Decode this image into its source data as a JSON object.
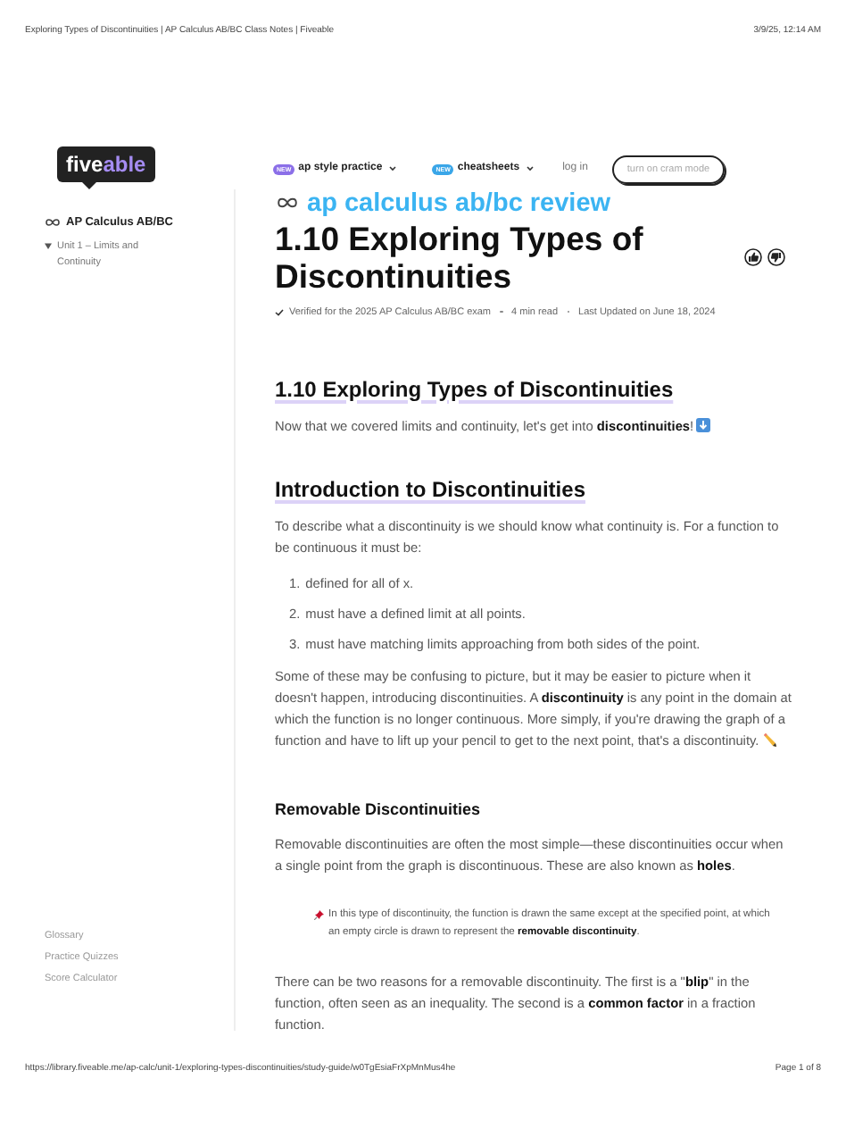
{
  "print_header": {
    "title": "Exploring Types of Discontinuities | AP Calculus AB/BC Class Notes | Fiveable",
    "datetime": "3/9/25, 12:14 AM"
  },
  "logo": [
    "five",
    "able"
  ],
  "nav": {
    "items": [
      {
        "badge": "NEW",
        "label": "ap style practice",
        "color": "#8b6fe8"
      },
      {
        "badge": "NEW",
        "label": "cheatsheets",
        "color": "#3aa6e8"
      }
    ],
    "login": "log in",
    "cram_button": "turn on cram mode"
  },
  "sidebar": {
    "course": "AP Calculus AB/BC",
    "unit": {
      "label": "Unit 1 – Limits and Continuity",
      "expanded": true
    },
    "links": [
      "Glossary",
      "Practice Quizzes",
      "Score Calculator"
    ]
  },
  "article": {
    "course_label": "ap calculus ab/bc review",
    "title": "1.10 Exploring Types of Discontinuities",
    "meta": [
      "Verified for the 2025 AP Calculus AB/BC exam",
      "4 min read",
      "Last Updated on June 18, 2024"
    ],
    "blocks": [
      {
        "kind": "h2",
        "text": "1.10 Exploring Types of Discontinuities"
      },
      {
        "kind": "p",
        "text": "Now that we covered limits and continuity, let's get into **discontinuities**!",
        "end_icon": {
          "kind": "arrow"
        }
      },
      {
        "kind": "h2",
        "text": "Introduction to Discontinuities"
      },
      {
        "kind": "p",
        "text": "To describe what a discontinuity is we should know what continuity is. For a function to be continuous it must be:"
      },
      {
        "kind": "ol",
        "items": [
          {
            "number": "1.",
            "text": "defined for all of x."
          },
          {
            "number": "2.",
            "text": "must have a defined limit at all points."
          },
          {
            "number": "3.",
            "text": "must have matching limits approaching from both sides of the point."
          }
        ]
      },
      {
        "kind": "p",
        "text": "Some of these may be confusing to picture, but it may be easier to picture when it doesn't happen, introducing discontinuities. A **discontinuity** is any point in the domain at which the function is no longer continuous. More simply, if you're drawing the graph of a function and have to lift up your pencil to get to the next point, that's a discontinuity.",
        "end_icon": {
          "kind": "pencil"
        }
      },
      {
        "kind": "h3",
        "text": "Removable Discontinuities"
      },
      {
        "kind": "p",
        "text": "Removable discontinuities are often the most simple—these discontinuities occur when a single point from the graph is discontinuous. These are also known as **holes**."
      },
      {
        "kind": "callout",
        "text": "In this type of discontinuity, the function is drawn the same except at the specified point, at which an empty circle is drawn to represent the **removable discontinuity**."
      },
      {
        "kind": "p",
        "text": "There can be two reasons for a removable discontinuity. The first is a \"**blip**\" in the function, often seen as an inequality. The second is a **common factor** in a fraction function."
      }
    ]
  },
  "print_footer": {
    "url": "https://library.fiveable.me/ap-calc/unit-1/exploring-types-discontinuities/study-guide/w0TgEsiaFrXpMnMus4he",
    "page": "Page 1 of 8"
  }
}
